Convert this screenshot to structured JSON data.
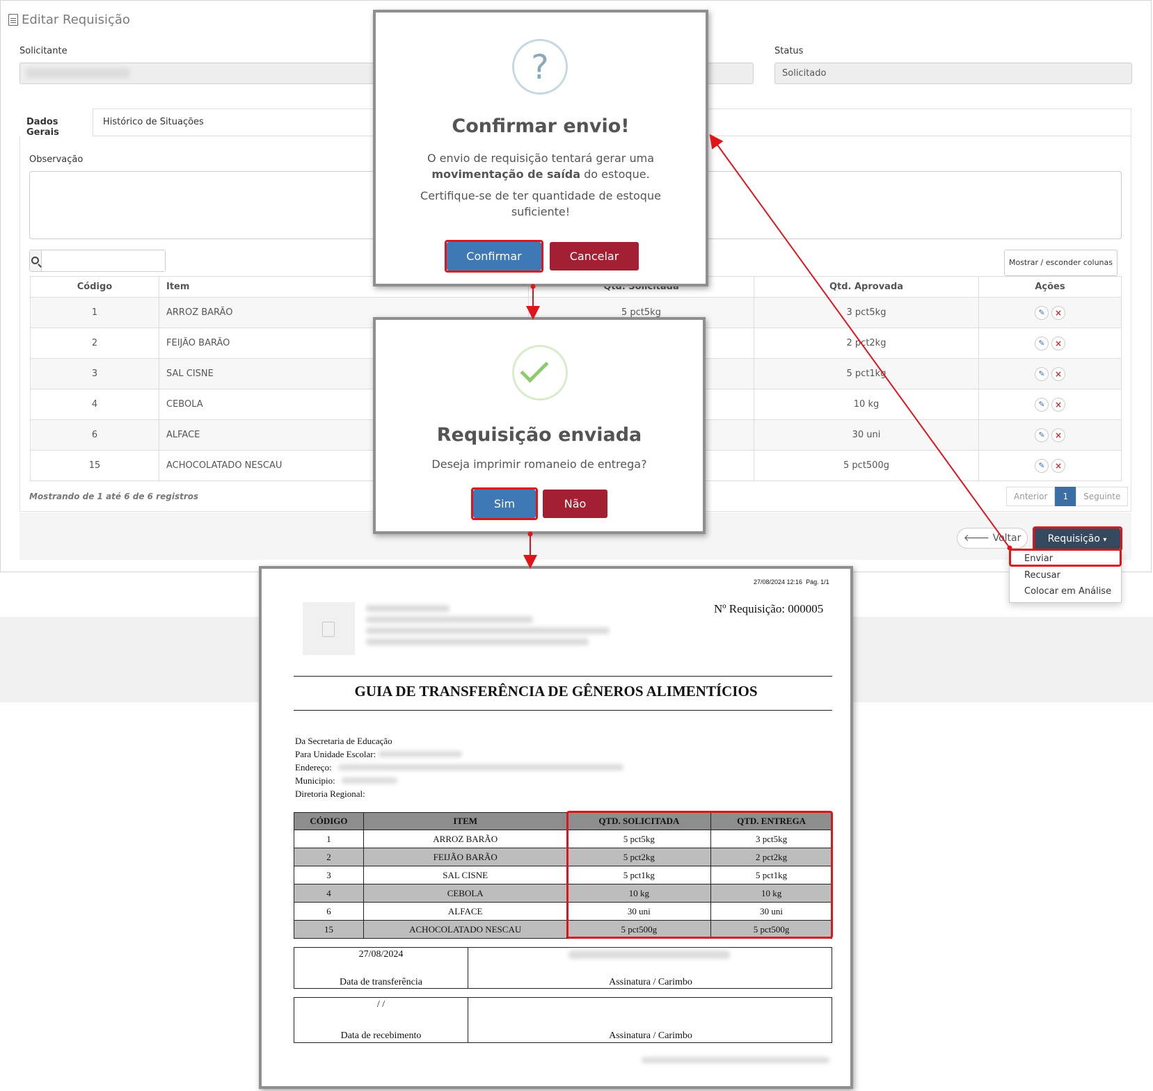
{
  "page": {
    "title": "Editar Requisição",
    "requester_label": "Solicitante",
    "status_label": "Status",
    "status_value": "Solicitado",
    "tabs": [
      "Dados Gerais",
      "Histórico de Situações"
    ],
    "observation_label": "Observação",
    "show_hide_columns": "Mostrar / esconder colunas",
    "table": {
      "headers": [
        "Código",
        "Item",
        "Qtd. Solicitada",
        "Qtd. Aprovada",
        "Ações"
      ],
      "rows": [
        {
          "code": "1",
          "item": "ARROZ BARÃO",
          "requested": "5 pct5kg",
          "approved": "3 pct5kg"
        },
        {
          "code": "2",
          "item": "FEIJÃO BARÃO",
          "requested": "",
          "approved": "2 pct2kg"
        },
        {
          "code": "3",
          "item": "SAL CISNE",
          "requested": "",
          "approved": "5 pct1kg"
        },
        {
          "code": "4",
          "item": "CEBOLA",
          "requested": "",
          "approved": "10 kg"
        },
        {
          "code": "6",
          "item": "ALFACE",
          "requested": "",
          "approved": "30 uni"
        },
        {
          "code": "15",
          "item": "ACHOCOLATADO NESCAU",
          "requested": "",
          "approved": "5 pct500g"
        }
      ]
    },
    "info": "Mostrando de 1 até 6 de 6 registros",
    "pager": {
      "prev": "Anterior",
      "current": "1",
      "next": "Seguinte"
    },
    "back_button": "Voltar",
    "requisition_button": "Requisição",
    "dropdown": [
      "Enviar",
      "Recusar",
      "Colocar em Análise"
    ]
  },
  "confirm_modal": {
    "icon": "?",
    "title": "Confirmar envio!",
    "text1a": "O envio de requisição tentará gerar uma",
    "text1b_bold": "movimentação de saída",
    "text1c": " do estoque.",
    "text2a": "Certifique-se de ter quantidade de estoque",
    "text2b": "suficiente!",
    "confirm": "Confirmar",
    "cancel": "Cancelar"
  },
  "sent_modal": {
    "title": "Requisição enviada",
    "text": "Deseja imprimir romaneio de entrega?",
    "yes": "Sim",
    "no": "Não"
  },
  "document": {
    "timestamp": "27/08/2024 12:16",
    "page": "Pág. 1/1",
    "req_number": "Nº Requisição: 000005",
    "title": "GUIA DE TRANSFERÊNCIA DE GÊNEROS ALIMENTÍCIOS",
    "from": "Da Secretaria de Educação",
    "to_label": "Para Unidade Escolar:",
    "address_label": "Endereço:",
    "city_label": "Municipio:",
    "region_label": "Diretoria Regional:",
    "headers": [
      "CÓDIGO",
      "ITEM",
      "QTD. SOLICITADA",
      "QTD. ENTREGA"
    ],
    "rows": [
      {
        "code": "1",
        "item": "ARROZ BARÃO",
        "requested": "5 pct5kg",
        "delivered": "3 pct5kg"
      },
      {
        "code": "2",
        "item": "FEIJÃO BARÃO",
        "requested": "5 pct2kg",
        "delivered": "2 pct2kg"
      },
      {
        "code": "3",
        "item": "SAL CISNE",
        "requested": "5 pct1kg",
        "delivered": "5 pct1kg"
      },
      {
        "code": "4",
        "item": "CEBOLA",
        "requested": "10 kg",
        "delivered": "10 kg"
      },
      {
        "code": "6",
        "item": "ALFACE",
        "requested": "30 uni",
        "delivered": "30 uni"
      },
      {
        "code": "15",
        "item": "ACHOCOLATADO NESCAU",
        "requested": "5 pct500g",
        "delivered": "5 pct500g"
      }
    ],
    "transfer_date": "27/08/2024",
    "transfer_label": "Data de transferência",
    "signature_label": "Assinatura / Carimbo",
    "receipt_date": "/      /",
    "receipt_label": "Data de recebimento"
  },
  "colors": {
    "accent_blue": "#3f79b5",
    "danger_red": "#a31f32",
    "highlight_red": "#e0151b",
    "dark_button": "#34495e"
  }
}
